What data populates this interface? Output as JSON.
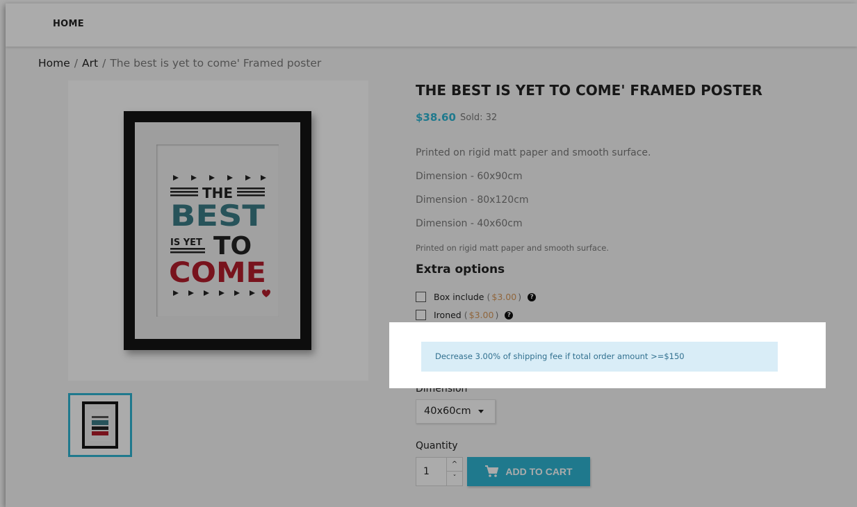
{
  "nav": {
    "home": "HOME"
  },
  "breadcrumb": {
    "items": [
      "Home",
      "Art",
      "The best is yet to come' Framed poster"
    ]
  },
  "product": {
    "title": "THE BEST IS YET TO COME' FRAMED POSTER",
    "price": "$38.60",
    "sold": "Sold: 32",
    "descriptions": [
      "Printed on rigid matt paper and smooth surface.",
      "Dimension - 60x90cm",
      "Dimension - 80x120cm",
      "Dimension - 40x60cm"
    ],
    "description_small": "Printed on rigid matt paper and smooth surface.",
    "poster_text": {
      "the": "THE",
      "best": "BEST",
      "is_yet": "IS YET",
      "to": "TO",
      "come": "COME"
    }
  },
  "extra_options": {
    "title": "Extra options",
    "items": [
      {
        "label": "Box include",
        "price": "$3.00"
      },
      {
        "label": "Ironed",
        "price": "$3.00"
      }
    ]
  },
  "alert": {
    "text": "Decrease 3.00% of shipping fee if total order amount >=$150"
  },
  "dimension": {
    "label": "Dimension",
    "selected": "40x60cm"
  },
  "quantity": {
    "label": "Quantity",
    "value": "1"
  },
  "cart": {
    "label": "ADD TO CART"
  },
  "colors": {
    "accent": "#2fb5d2",
    "overlay": "rgba(0,0,0,0.33)",
    "alert_bg": "#d9edf7",
    "alert_text": "#31708f",
    "option_price": "#d7985a"
  }
}
